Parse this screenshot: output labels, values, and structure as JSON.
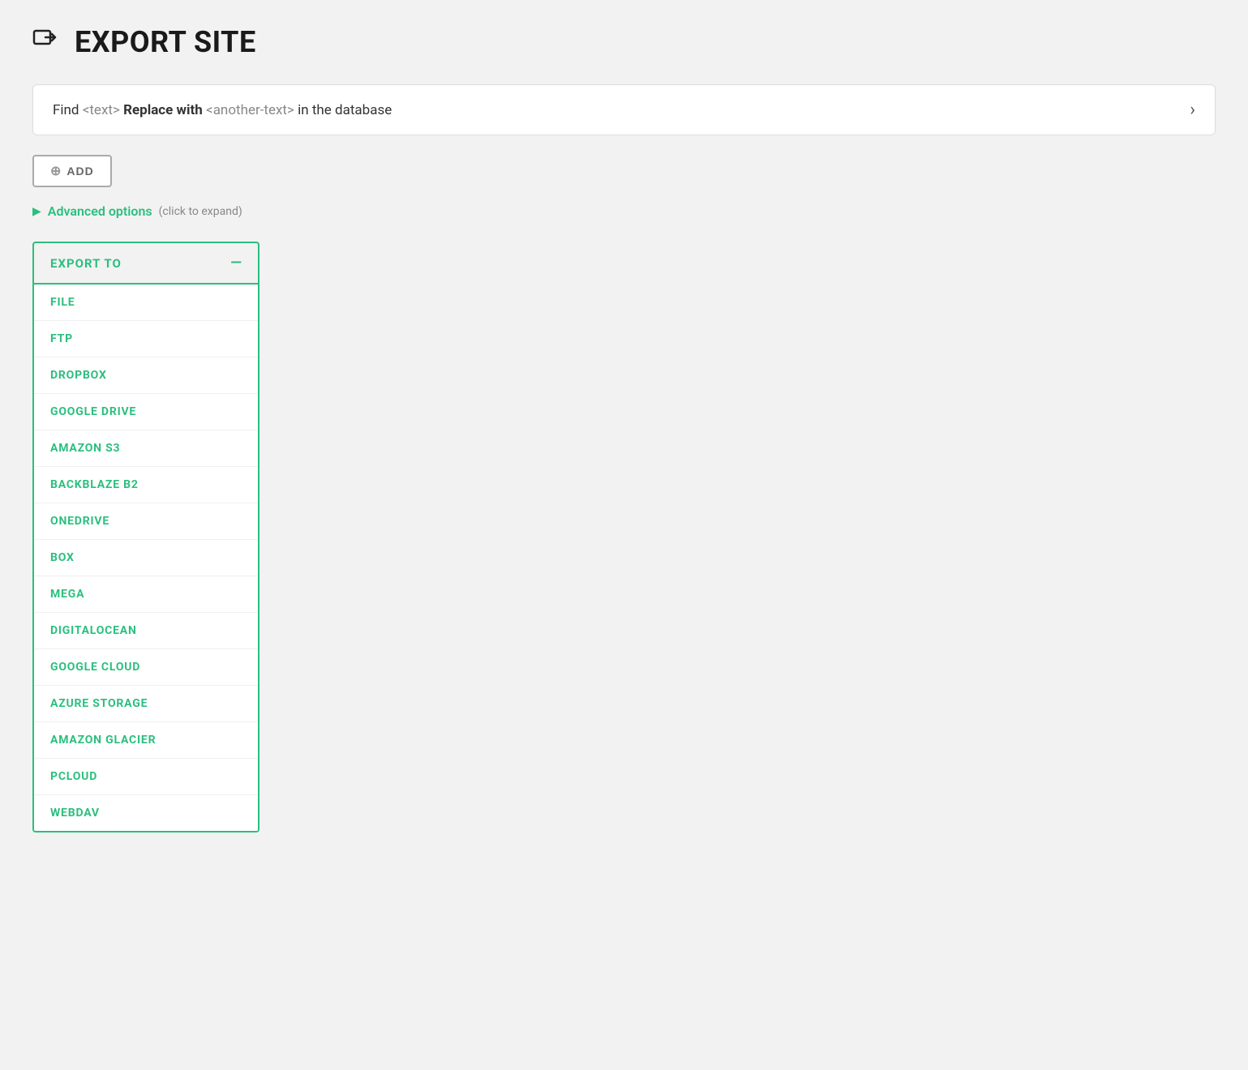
{
  "page": {
    "title": "EXPORT SITE",
    "icon_label": "export-site-icon"
  },
  "find_replace": {
    "text_parts": {
      "find": "Find",
      "tag1": "<text>",
      "bold": "Replace with",
      "tag2": "<another-text>",
      "suffix": "in the database"
    }
  },
  "add_button": {
    "label": "ADD",
    "plus": "⊕"
  },
  "advanced_options": {
    "label": "Advanced options",
    "hint": "(click to expand)"
  },
  "export_to_panel": {
    "title": "EXPORT TO",
    "collapse_icon": "—",
    "items": [
      {
        "label": "FILE"
      },
      {
        "label": "FTP"
      },
      {
        "label": "DROPBOX"
      },
      {
        "label": "GOOGLE DRIVE"
      },
      {
        "label": "AMAZON S3"
      },
      {
        "label": "BACKBLAZE B2"
      },
      {
        "label": "ONEDRIVE"
      },
      {
        "label": "BOX"
      },
      {
        "label": "MEGA"
      },
      {
        "label": "DIGITALOCEAN"
      },
      {
        "label": "GOOGLE CLOUD"
      },
      {
        "label": "AZURE STORAGE"
      },
      {
        "label": "AMAZON GLACIER"
      },
      {
        "label": "PCLOUD"
      },
      {
        "label": "WEBDAV"
      }
    ]
  }
}
